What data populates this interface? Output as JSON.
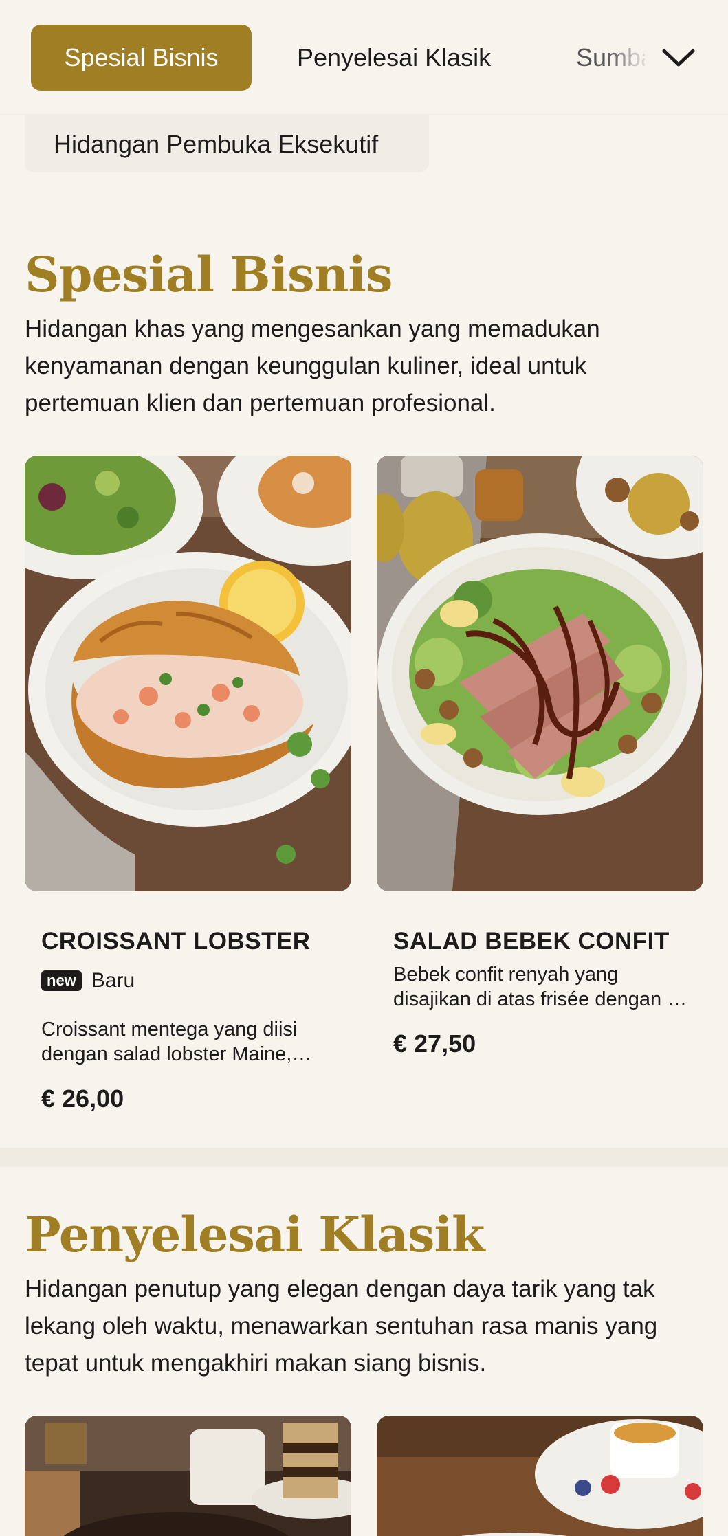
{
  "nav": {
    "tabs": [
      "Spesial Bisnis",
      "Penyelesai Klasik",
      "Sumbat"
    ],
    "active_index": 0,
    "sub_chip": "Hidangan Pembuka Eksekutif"
  },
  "colors": {
    "accent": "#a07f24",
    "background": "#f7f4ee",
    "text": "#1d1c1a"
  },
  "sections": [
    {
      "title": "Spesial Bisnis",
      "description": "Hidangan khas yang mengesankan yang memadukan kenyamanan dengan keunggulan kuliner, ideal untuk pertemuan klien dan pertemuan profesional.",
      "items": [
        {
          "name": "CROISSANT LOBSTER",
          "badge": "new",
          "badge_label": "Baru",
          "description": "Croissant mentega yang diisi dengan salad lobster Maine, selada dan lemon",
          "price": "€ 26,00"
        },
        {
          "name": "SALAD BEBEK CONFIT",
          "description": "Bebek confit renyah yang disajikan di atas frisée dengan pir, kenari dan saus balsamik",
          "price": "€ 27,50"
        }
      ]
    },
    {
      "title": "Penyelesai Klasik",
      "description": "Hidangan penutup yang elegan dengan daya tarik yang tak lekang oleh waktu, menawarkan sentuhan rasa manis yang tepat untuk mengakhiri makan siang bisnis."
    }
  ]
}
